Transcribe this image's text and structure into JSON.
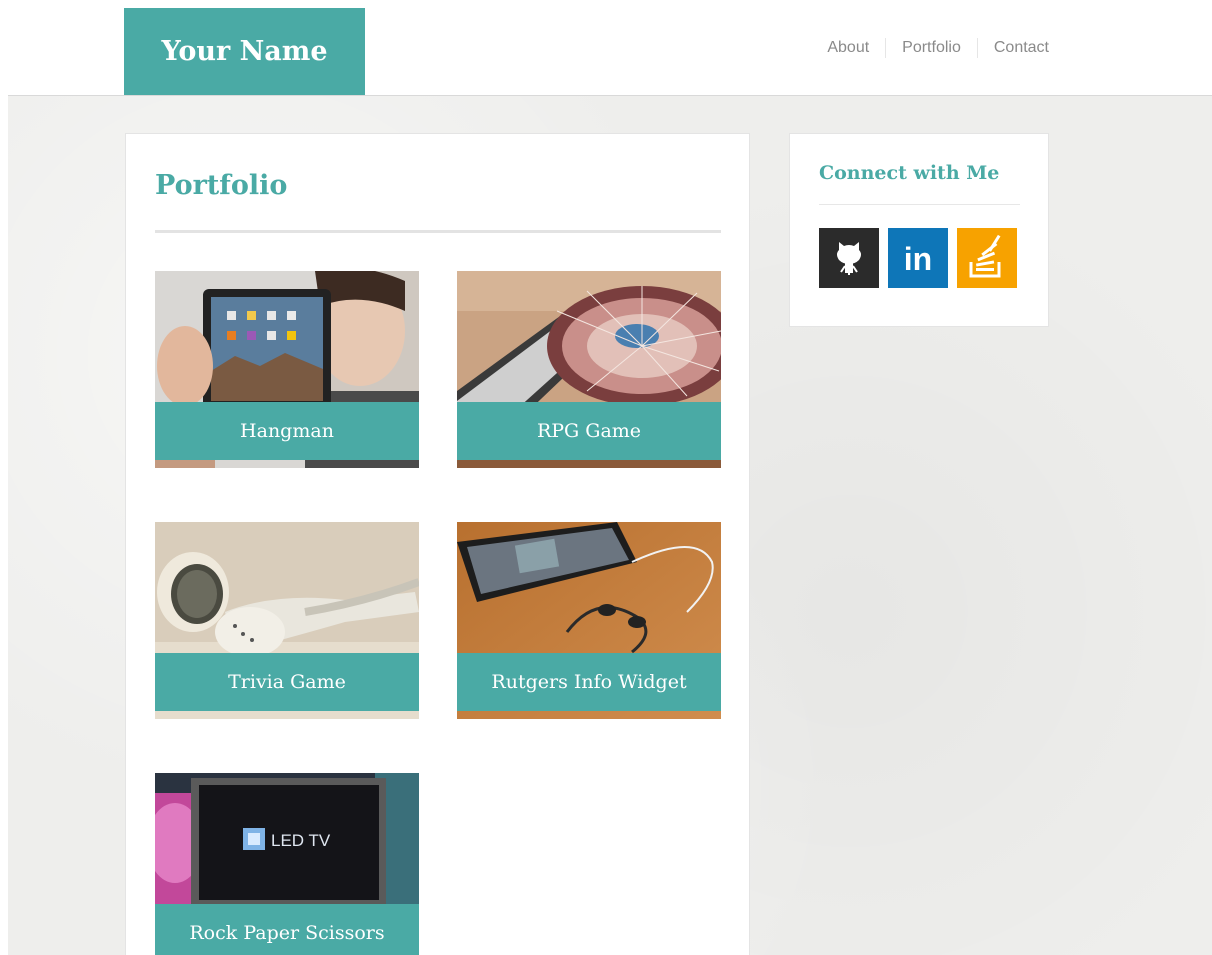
{
  "header": {
    "brand": "Your Name",
    "nav": [
      "About",
      "Portfolio",
      "Contact"
    ]
  },
  "main": {
    "title": "Portfolio",
    "projects": [
      {
        "title": "Hangman",
        "image": "tablet-photo"
      },
      {
        "title": "RPG Game",
        "image": "dj-turntable-photo"
      },
      {
        "title": "Trivia Game",
        "image": "earbuds-photo"
      },
      {
        "title": "Rutgers Info Widget",
        "image": "phone-earphones-photo"
      },
      {
        "title": "Rock Paper Scissors",
        "image": "led-tv-photo"
      }
    ]
  },
  "sidebar": {
    "title": "Connect with Me",
    "links": [
      {
        "icon": "github-icon",
        "color": "#2b2b2b"
      },
      {
        "icon": "linkedin-icon",
        "text": "in",
        "color": "#0e76b8"
      },
      {
        "icon": "stackoverflow-icon",
        "color": "#f7a200"
      }
    ]
  },
  "colors": {
    "accent": "#4aaaa5",
    "nav_text": "#8a8a8a",
    "page_bg": "#eeeeec"
  }
}
